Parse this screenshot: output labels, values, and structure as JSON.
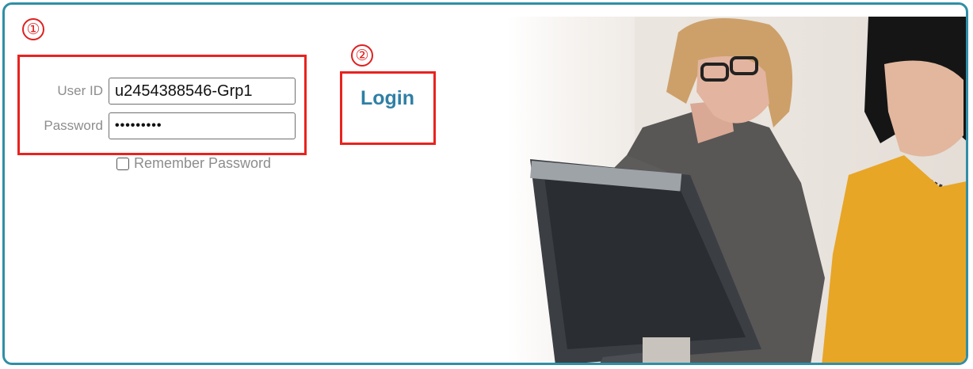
{
  "annotations": {
    "step1": "①",
    "step2": "②"
  },
  "login_form": {
    "user_id_label": "User ID",
    "user_id_value": "u2454388546-Grp1",
    "password_label": "Password",
    "password_value": "•••••••••",
    "remember_label": "Remember Password",
    "remember_checked": false,
    "login_label": "Login"
  },
  "colors": {
    "frame_border": "#2f8fa6",
    "annotation_red": "#e8231f",
    "login_link": "#2f7fa5",
    "label_gray": "#8d8d8d"
  },
  "hero_image": {
    "icon": "photo-two-women-at-computer"
  }
}
